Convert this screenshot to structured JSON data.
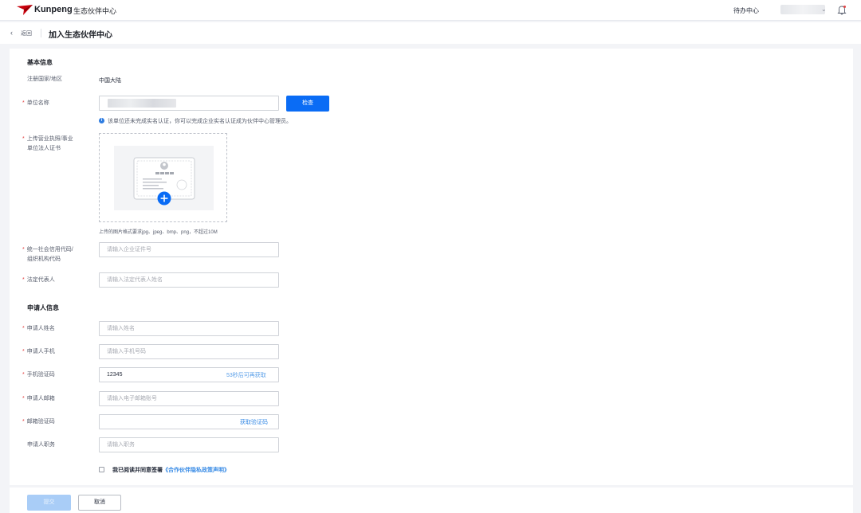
{
  "topbar": {
    "brand": "Kunpeng",
    "app_title": "生态伙伴中心",
    "todo": "待办中心",
    "user_chevron": "⌄"
  },
  "crumb": {
    "back_icon": "‹",
    "back_label": "返回",
    "page_title": "加入生态伙伴中心"
  },
  "basic": {
    "section_title": "基本信息",
    "region_label": "注册国家/地区",
    "region_value": "中国大陆",
    "unit_label": "单位名称",
    "check_button": "检查",
    "info_icon": "i",
    "info_text": "该单位还未完成实名认证，你可以完成企业实名认证成为伙伴中心管理员。",
    "license_label_1": "上传营业执照/事业",
    "license_label_2": "单位法人证书",
    "upload_hint": "上传的图片格式要求jpg、jpeg、bmp、png，不超过10M",
    "credit_label_1": "统一社会信用代码/",
    "credit_label_2": "组织机构代码",
    "credit_placeholder": "请输入企业证件号",
    "legal_label": "法定代表人",
    "legal_placeholder": "请输入法定代表人姓名"
  },
  "applicant": {
    "section_title": "申请人信息",
    "name_label": "申请人姓名",
    "name_placeholder": "请输入姓名",
    "phone_label": "申请人手机",
    "phone_placeholder": "请输入手机号码",
    "sms_label": "手机验证码",
    "sms_value": "12345",
    "sms_resend": "53秒后可再获取",
    "email_label": "申请人邮箱",
    "email_placeholder": "请输入电子邮箱账号",
    "email_code_label": "邮箱验证码",
    "email_code_link": "获取验证码",
    "title_label": "申请人职务",
    "title_placeholder": "请输入职务"
  },
  "agreement": {
    "text": "我已阅读并同意签署",
    "link": "《合作伙伴隐私政策声明》"
  },
  "footer": {
    "submit": "提交",
    "cancel": "取消"
  },
  "required_mark": "*",
  "colors": {
    "primary": "#0a6cf5",
    "link": "#3a8ce6",
    "required": "#e34343",
    "disabled_primary": "#a9cdf7"
  }
}
